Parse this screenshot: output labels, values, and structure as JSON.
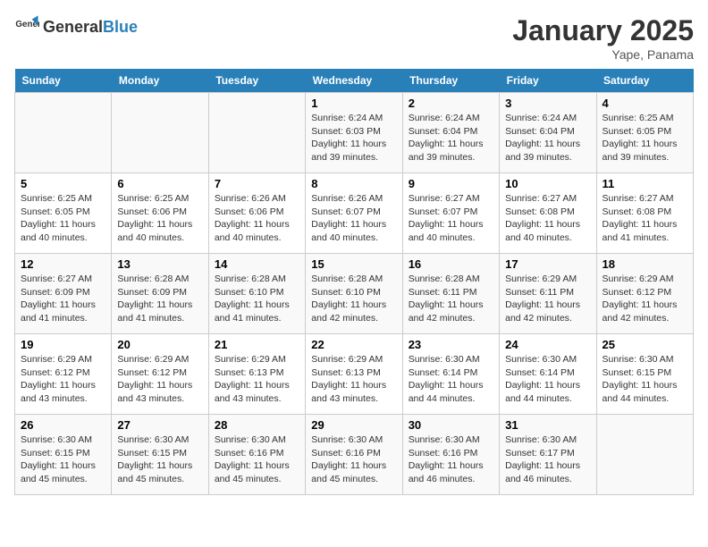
{
  "header": {
    "logo_general": "General",
    "logo_blue": "Blue",
    "month_year": "January 2025",
    "location": "Yape, Panama"
  },
  "days_of_week": [
    "Sunday",
    "Monday",
    "Tuesday",
    "Wednesday",
    "Thursday",
    "Friday",
    "Saturday"
  ],
  "weeks": [
    [
      {
        "day": "",
        "info": ""
      },
      {
        "day": "",
        "info": ""
      },
      {
        "day": "",
        "info": ""
      },
      {
        "day": "1",
        "info": "Sunrise: 6:24 AM\nSunset: 6:03 PM\nDaylight: 11 hours and 39 minutes."
      },
      {
        "day": "2",
        "info": "Sunrise: 6:24 AM\nSunset: 6:04 PM\nDaylight: 11 hours and 39 minutes."
      },
      {
        "day": "3",
        "info": "Sunrise: 6:24 AM\nSunset: 6:04 PM\nDaylight: 11 hours and 39 minutes."
      },
      {
        "day": "4",
        "info": "Sunrise: 6:25 AM\nSunset: 6:05 PM\nDaylight: 11 hours and 39 minutes."
      }
    ],
    [
      {
        "day": "5",
        "info": "Sunrise: 6:25 AM\nSunset: 6:05 PM\nDaylight: 11 hours and 40 minutes."
      },
      {
        "day": "6",
        "info": "Sunrise: 6:25 AM\nSunset: 6:06 PM\nDaylight: 11 hours and 40 minutes."
      },
      {
        "day": "7",
        "info": "Sunrise: 6:26 AM\nSunset: 6:06 PM\nDaylight: 11 hours and 40 minutes."
      },
      {
        "day": "8",
        "info": "Sunrise: 6:26 AM\nSunset: 6:07 PM\nDaylight: 11 hours and 40 minutes."
      },
      {
        "day": "9",
        "info": "Sunrise: 6:27 AM\nSunset: 6:07 PM\nDaylight: 11 hours and 40 minutes."
      },
      {
        "day": "10",
        "info": "Sunrise: 6:27 AM\nSunset: 6:08 PM\nDaylight: 11 hours and 40 minutes."
      },
      {
        "day": "11",
        "info": "Sunrise: 6:27 AM\nSunset: 6:08 PM\nDaylight: 11 hours and 41 minutes."
      }
    ],
    [
      {
        "day": "12",
        "info": "Sunrise: 6:27 AM\nSunset: 6:09 PM\nDaylight: 11 hours and 41 minutes."
      },
      {
        "day": "13",
        "info": "Sunrise: 6:28 AM\nSunset: 6:09 PM\nDaylight: 11 hours and 41 minutes."
      },
      {
        "day": "14",
        "info": "Sunrise: 6:28 AM\nSunset: 6:10 PM\nDaylight: 11 hours and 41 minutes."
      },
      {
        "day": "15",
        "info": "Sunrise: 6:28 AM\nSunset: 6:10 PM\nDaylight: 11 hours and 42 minutes."
      },
      {
        "day": "16",
        "info": "Sunrise: 6:28 AM\nSunset: 6:11 PM\nDaylight: 11 hours and 42 minutes."
      },
      {
        "day": "17",
        "info": "Sunrise: 6:29 AM\nSunset: 6:11 PM\nDaylight: 11 hours and 42 minutes."
      },
      {
        "day": "18",
        "info": "Sunrise: 6:29 AM\nSunset: 6:12 PM\nDaylight: 11 hours and 42 minutes."
      }
    ],
    [
      {
        "day": "19",
        "info": "Sunrise: 6:29 AM\nSunset: 6:12 PM\nDaylight: 11 hours and 43 minutes."
      },
      {
        "day": "20",
        "info": "Sunrise: 6:29 AM\nSunset: 6:12 PM\nDaylight: 11 hours and 43 minutes."
      },
      {
        "day": "21",
        "info": "Sunrise: 6:29 AM\nSunset: 6:13 PM\nDaylight: 11 hours and 43 minutes."
      },
      {
        "day": "22",
        "info": "Sunrise: 6:29 AM\nSunset: 6:13 PM\nDaylight: 11 hours and 43 minutes."
      },
      {
        "day": "23",
        "info": "Sunrise: 6:30 AM\nSunset: 6:14 PM\nDaylight: 11 hours and 44 minutes."
      },
      {
        "day": "24",
        "info": "Sunrise: 6:30 AM\nSunset: 6:14 PM\nDaylight: 11 hours and 44 minutes."
      },
      {
        "day": "25",
        "info": "Sunrise: 6:30 AM\nSunset: 6:15 PM\nDaylight: 11 hours and 44 minutes."
      }
    ],
    [
      {
        "day": "26",
        "info": "Sunrise: 6:30 AM\nSunset: 6:15 PM\nDaylight: 11 hours and 45 minutes."
      },
      {
        "day": "27",
        "info": "Sunrise: 6:30 AM\nSunset: 6:15 PM\nDaylight: 11 hours and 45 minutes."
      },
      {
        "day": "28",
        "info": "Sunrise: 6:30 AM\nSunset: 6:16 PM\nDaylight: 11 hours and 45 minutes."
      },
      {
        "day": "29",
        "info": "Sunrise: 6:30 AM\nSunset: 6:16 PM\nDaylight: 11 hours and 45 minutes."
      },
      {
        "day": "30",
        "info": "Sunrise: 6:30 AM\nSunset: 6:16 PM\nDaylight: 11 hours and 46 minutes."
      },
      {
        "day": "31",
        "info": "Sunrise: 6:30 AM\nSunset: 6:17 PM\nDaylight: 11 hours and 46 minutes."
      },
      {
        "day": "",
        "info": ""
      }
    ]
  ]
}
